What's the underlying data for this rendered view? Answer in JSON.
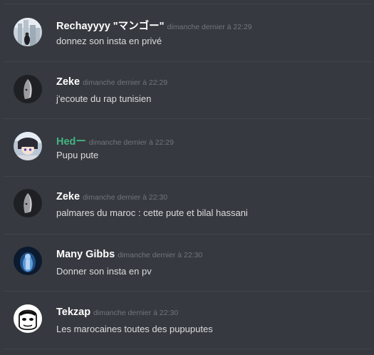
{
  "colors": {
    "background": "#36393f",
    "divider": "#40444b",
    "username_default": "#ffffff",
    "username_role_green": "#43b581",
    "timestamp": "#72767d",
    "message_text": "#dcddde"
  },
  "messages": [
    {
      "author": "Rechayyyy \"マンゴー\"",
      "timestamp": "dimanche dernier à 22:29",
      "content": "donnez son insta en privé",
      "avatar_icon": "city-photo-avatar-icon"
    },
    {
      "author": "Zeke",
      "timestamp": "dimanche dernier à 22:29",
      "content": "j'ecoute du rap tunisien",
      "avatar_icon": "dark-hooded-face-avatar-icon"
    },
    {
      "author": "Hedー",
      "timestamp": "dimanche dernier à 22:29",
      "content": "Pupu pute",
      "avatar_icon": "anime-character-avatar-icon"
    },
    {
      "author": "Zeke",
      "timestamp": "dimanche dernier à 22:30",
      "content": "palmares du maroc : cette pute et bilal hassani",
      "avatar_icon": "dark-hooded-face-avatar-icon"
    },
    {
      "author": "Many Gibbs",
      "timestamp": "dimanche dernier à 22:30",
      "content": "Donner son insta en pv",
      "avatar_icon": "blue-figure-avatar-icon"
    },
    {
      "author": "Tekzap",
      "timestamp": "dimanche dernier à 22:30",
      "content": "Les marocaines toutes des pupuputes",
      "avatar_icon": "cartoon-face-avatar-icon"
    }
  ]
}
